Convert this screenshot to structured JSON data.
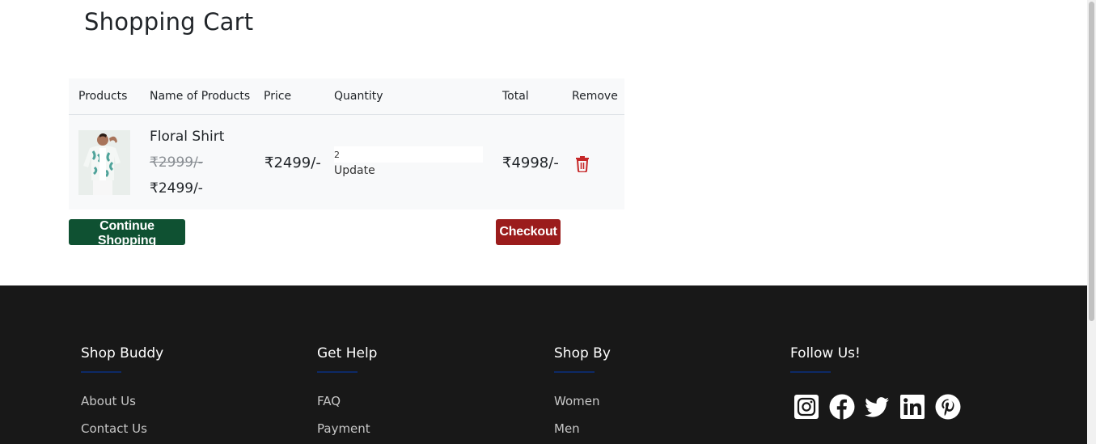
{
  "cart": {
    "title": "Shopping Cart",
    "columns": [
      "Products",
      "Name of Products",
      "Price",
      "Quantity",
      "Total",
      "Remove"
    ],
    "items": [
      {
        "name": "Floral Shirt",
        "original_price": "₹2999/-",
        "discounted_price": "₹2499/-",
        "price": "₹2499/-",
        "quantity": "2",
        "update_label": "Update",
        "total": "₹4998/-",
        "remove_icon": "trash-icon"
      }
    ],
    "continue_label": "Continue Shopping",
    "checkout_label": "Checkout"
  },
  "colors": {
    "continue_bg": "#0f5132",
    "checkout_bg": "#9b1c1c",
    "trash": "#c62828",
    "footer_bg": "#181818"
  },
  "footer": {
    "columns": [
      {
        "title": "Shop Buddy",
        "links": [
          "About Us",
          "Contact Us"
        ]
      },
      {
        "title": "Get Help",
        "links": [
          "FAQ",
          "Payment"
        ]
      },
      {
        "title": "Shop By",
        "links": [
          "Women",
          "Men"
        ]
      },
      {
        "title": "Follow Us!",
        "social": [
          "instagram-icon",
          "facebook-icon",
          "twitter-icon",
          "linkedin-icon",
          "pinterest-icon"
        ]
      }
    ]
  }
}
